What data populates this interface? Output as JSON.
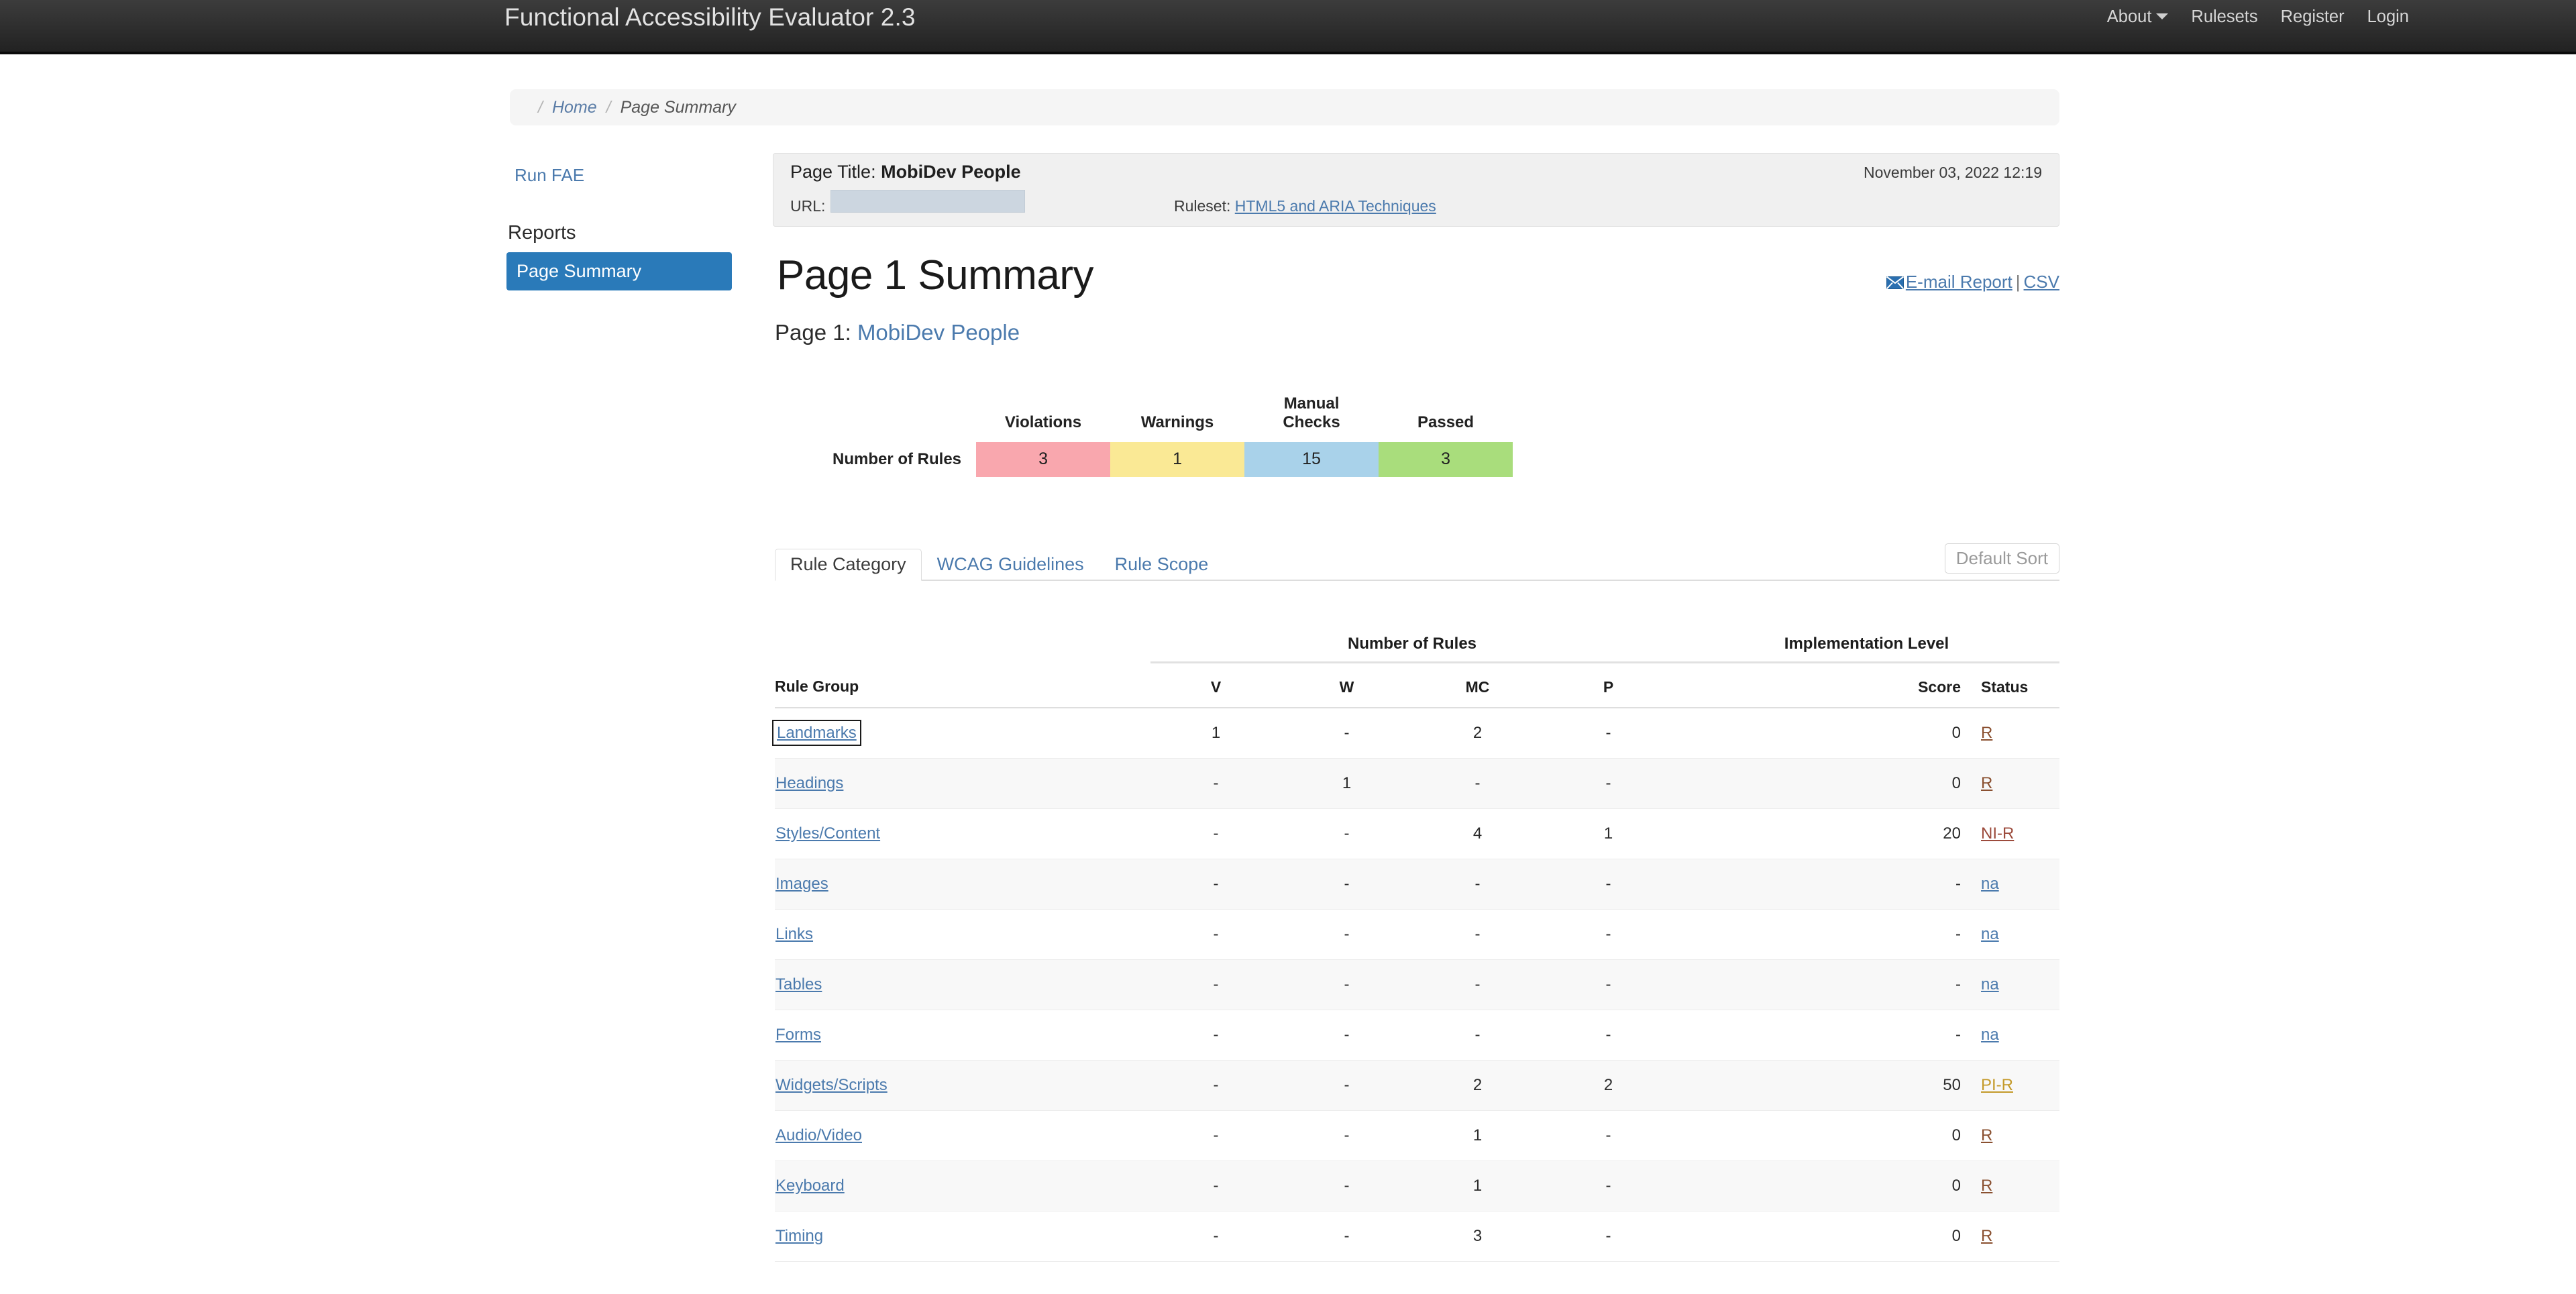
{
  "navbar": {
    "brand": "Functional Accessibility Evaluator 2.3",
    "links": [
      {
        "label": "About",
        "has_caret": true
      },
      {
        "label": "Rulesets",
        "has_caret": false
      },
      {
        "label": "Register",
        "has_caret": false
      },
      {
        "label": "Login",
        "has_caret": false
      }
    ]
  },
  "breadcrumb": {
    "leading_separator": "/",
    "home": "Home",
    "separator": "/",
    "current": "Page Summary"
  },
  "sidebar": {
    "run_fae": "Run FAE",
    "reports_heading": "Reports",
    "active_item": "Page Summary"
  },
  "info_panel": {
    "page_title_label": "Page Title:",
    "page_title_value": "MobiDev People",
    "timestamp": "November 03, 2022 12:19",
    "url_label": "URL:",
    "url_value": "",
    "ruleset_label": "Ruleset:",
    "ruleset_value": "HTML5 and ARIA Techniques"
  },
  "heading": {
    "title": "Page 1 Summary",
    "subtitle_prefix": "Page 1:",
    "subtitle_link": "MobiDev People"
  },
  "report_links": {
    "mail_icon": "envelope-icon",
    "email_report": "E-mail Report",
    "divider": "|",
    "csv": "CSV"
  },
  "stats": {
    "row_label": "Number of Rules",
    "columns": [
      {
        "label": "Violations",
        "value": "3",
        "color": "#f9a7ae"
      },
      {
        "label": "Warnings",
        "value": "1",
        "color": "#fae995"
      },
      {
        "label": "Manual\nChecks",
        "value": "15",
        "color": "#a9d2ea"
      },
      {
        "label": "Passed",
        "value": "3",
        "color": "#a9dd7c"
      }
    ]
  },
  "tabs": {
    "items": [
      {
        "label": "Rule Category",
        "active": true
      },
      {
        "label": "WCAG Guidelines",
        "active": false
      },
      {
        "label": "Rule Scope",
        "active": false
      }
    ],
    "sort_button": "Default Sort"
  },
  "table": {
    "group_headers": {
      "number_of_rules": "Number of Rules",
      "implementation_level": "Implementation Level"
    },
    "column_headers": {
      "rule_group": "Rule Group",
      "v": "V",
      "w": "W",
      "mc": "MC",
      "p": "P",
      "score": "Score",
      "status": "Status"
    },
    "rows": [
      {
        "group": "Landmarks",
        "v": "1",
        "w": "-",
        "mc": "2",
        "p": "-",
        "score": "0",
        "status": "R",
        "status_class": "st-R",
        "focused": true
      },
      {
        "group": "Headings",
        "v": "-",
        "w": "1",
        "mc": "-",
        "p": "-",
        "score": "0",
        "status": "R",
        "status_class": "st-R",
        "focused": false
      },
      {
        "group": "Styles/Content",
        "v": "-",
        "w": "-",
        "mc": "4",
        "p": "1",
        "score": "20",
        "status": "NI-R",
        "status_class": "st-NIR",
        "focused": false
      },
      {
        "group": "Images",
        "v": "-",
        "w": "-",
        "mc": "-",
        "p": "-",
        "score": "-",
        "status": "na",
        "status_class": "st-na",
        "focused": false
      },
      {
        "group": "Links",
        "v": "-",
        "w": "-",
        "mc": "-",
        "p": "-",
        "score": "-",
        "status": "na",
        "status_class": "st-na",
        "focused": false
      },
      {
        "group": "Tables",
        "v": "-",
        "w": "-",
        "mc": "-",
        "p": "-",
        "score": "-",
        "status": "na",
        "status_class": "st-na",
        "focused": false
      },
      {
        "group": "Forms",
        "v": "-",
        "w": "-",
        "mc": "-",
        "p": "-",
        "score": "-",
        "status": "na",
        "status_class": "st-na",
        "focused": false
      },
      {
        "group": "Widgets/Scripts",
        "v": "-",
        "w": "-",
        "mc": "2",
        "p": "2",
        "score": "50",
        "status": "PI-R",
        "status_class": "st-PIR",
        "focused": false
      },
      {
        "group": "Audio/Video",
        "v": "-",
        "w": "-",
        "mc": "1",
        "p": "-",
        "score": "0",
        "status": "R",
        "status_class": "st-R",
        "focused": false
      },
      {
        "group": "Keyboard",
        "v": "-",
        "w": "-",
        "mc": "1",
        "p": "-",
        "score": "0",
        "status": "R",
        "status_class": "st-R",
        "focused": false
      },
      {
        "group": "Timing",
        "v": "-",
        "w": "-",
        "mc": "3",
        "p": "-",
        "score": "0",
        "status": "R",
        "status_class": "st-R",
        "focused": false
      }
    ]
  }
}
